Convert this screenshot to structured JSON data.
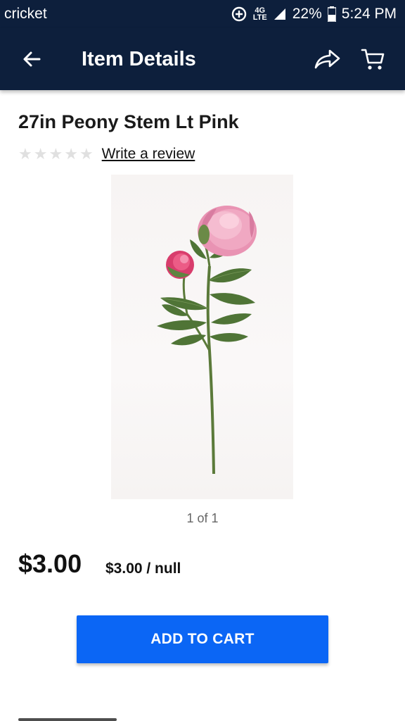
{
  "status_bar": {
    "carrier": "cricket",
    "network": "4G LTE",
    "battery": "22%",
    "time": "5:24 PM",
    "icons": [
      "data-saver-icon",
      "lte-icon",
      "signal-icon",
      "battery-icon"
    ]
  },
  "app_bar": {
    "title": "Item Details",
    "back_icon": "back-arrow-icon",
    "share_icon": "share-icon",
    "cart_icon": "cart-icon"
  },
  "product": {
    "title": "27in Peony Stem Lt Pink",
    "rating_stars": 0,
    "rating_max": 5,
    "review_link": "Write a review",
    "image_counter": "1 of 1",
    "price": "$3.00",
    "unit_price": "$3.00 / null"
  },
  "actions": {
    "add_to_cart": "ADD TO CART"
  },
  "colors": {
    "header_bg": "#0d1f3c",
    "primary_button": "#0b66f5"
  }
}
